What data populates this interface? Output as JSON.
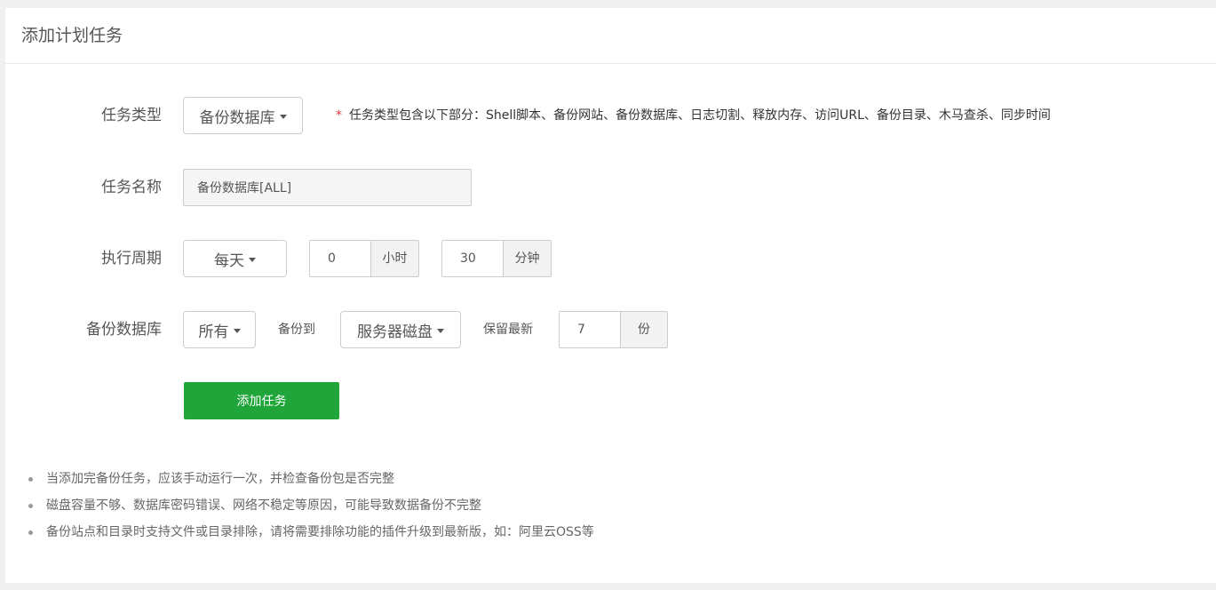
{
  "panel": {
    "title": "添加计划任务"
  },
  "task_type": {
    "label": "任务类型",
    "selected": "备份数据库",
    "hint_star": "*",
    "hint": "任务类型包含以下部分：Shell脚本、备份网站、备份数据库、日志切割、释放内存、访问URL、备份目录、木马查杀、同步时间"
  },
  "task_name": {
    "label": "任务名称",
    "value": "备份数据库[ALL]"
  },
  "cycle": {
    "label": "执行周期",
    "period": "每天",
    "hour_value": "0",
    "hour_unit": "小时",
    "minute_value": "30",
    "minute_unit": "分钟"
  },
  "backup_db": {
    "label": "备份数据库",
    "database": "所有",
    "backup_to_label": "备份到",
    "backup_to": "服务器磁盘",
    "keep_label": "保留最新",
    "keep_value": "7",
    "keep_unit": "份"
  },
  "submit_label": "添加任务",
  "tips": [
    "当添加完备份任务，应该手动运行一次，并检查备份包是否完整",
    "磁盘容量不够、数据库密码错误、网络不稳定等原因，可能导致数据备份不完整",
    "备份站点和目录时支持文件或目录排除，请将需要排除功能的插件升级到最新版，如：阿里云OSS等"
  ],
  "colors": {
    "accent": "#20a53a",
    "required_star": "#e4393c"
  }
}
